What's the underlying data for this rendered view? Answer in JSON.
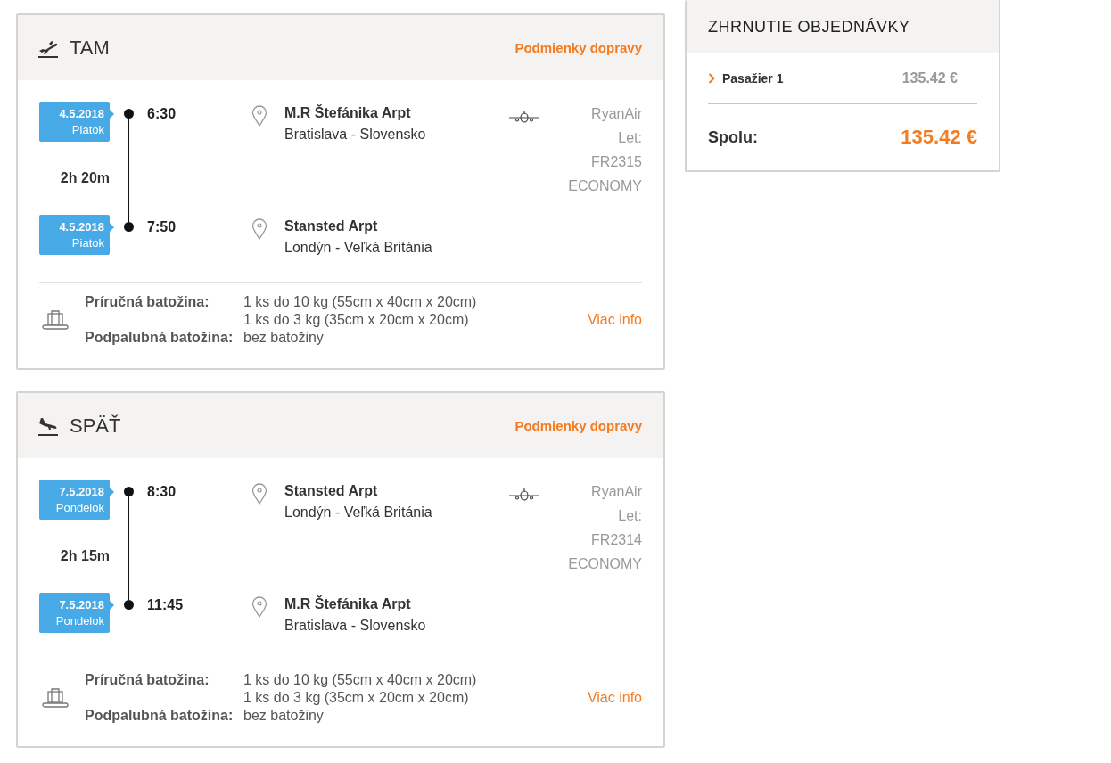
{
  "legs": [
    {
      "kind": "takeoff",
      "direction": "TAM",
      "conditions_link": "Podmienky dopravy",
      "departure": {
        "date": "4.5.2018",
        "weekday": "Piatok",
        "time": "6:30",
        "airport": "M.R Štefánika Arpt",
        "city": "Bratislava - Slovensko"
      },
      "duration": "2h 20m",
      "arrival": {
        "date": "4.5.2018",
        "weekday": "Piatok",
        "time": "7:50",
        "airport": "Stansted Arpt",
        "city": "Londýn - Veľká Británia"
      },
      "airline": "RyanAir",
      "flight_label": "Let:",
      "flight_number": "FR2315",
      "cabin": "ECONOMY",
      "baggage": [
        {
          "label": "Príručná batožina:",
          "values": [
            "1 ks do 10 kg (55cm x 40cm x 20cm)",
            "1 ks do 3 kg (35cm x 20cm x 20cm)"
          ]
        },
        {
          "label": "Podpalubná batožina:",
          "values": [
            "bez batožiny"
          ]
        }
      ],
      "more_info": "Viac info"
    },
    {
      "kind": "landing",
      "direction": "SPÄŤ",
      "conditions_link": "Podmienky dopravy",
      "departure": {
        "date": "7.5.2018",
        "weekday": "Pondelok",
        "time": "8:30",
        "airport": "Stansted Arpt",
        "city": "Londýn - Veľká Británia"
      },
      "duration": "2h 15m",
      "arrival": {
        "date": "7.5.2018",
        "weekday": "Pondelok",
        "time": "11:45",
        "airport": "M.R Štefánika Arpt",
        "city": "Bratislava - Slovensko"
      },
      "airline": "RyanAir",
      "flight_label": "Let:",
      "flight_number": "FR2314",
      "cabin": "ECONOMY",
      "baggage": [
        {
          "label": "Príručná batožina:",
          "values": [
            "1 ks do 10 kg (55cm x 40cm x 20cm)",
            "1 ks do 3 kg (35cm x 20cm x 20cm)"
          ]
        },
        {
          "label": "Podpalubná batožina:",
          "values": [
            "bez batožiny"
          ]
        }
      ],
      "more_info": "Viac info"
    }
  ],
  "summary": {
    "title": "ZHRNUTIE OBJEDNÁVKY",
    "passengers": [
      {
        "label": "Pasažier 1",
        "price": "135.42 €"
      }
    ],
    "total_label": "Spolu:",
    "total": "135.42 €"
  }
}
